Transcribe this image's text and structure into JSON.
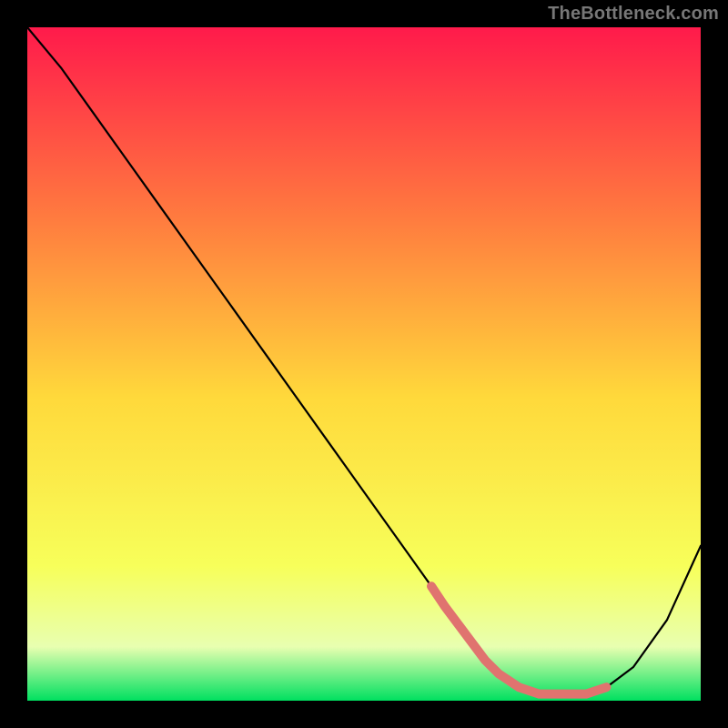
{
  "watermark": "TheBottleneck.com",
  "colors": {
    "frame_bg": "#000000",
    "gradient_top": "#ff1a4b",
    "gradient_mid1": "#ff7a3f",
    "gradient_mid2": "#ffd93b",
    "gradient_mid3": "#f7ff5a",
    "gradient_bottom_band": "#e8ffb0",
    "gradient_bottom": "#00e060",
    "curve": "#000000",
    "highlight": "#e0736f"
  },
  "chart_data": {
    "type": "line",
    "title": "",
    "xlabel": "",
    "ylabel": "",
    "xlim": [
      0,
      100
    ],
    "ylim": [
      0,
      100
    ],
    "grid": false,
    "legend": false,
    "series": [
      {
        "name": "bottleneck-curve",
        "x": [
          0,
          5,
          10,
          15,
          20,
          25,
          30,
          35,
          40,
          45,
          50,
          55,
          60,
          62,
          65,
          68,
          70,
          73,
          76,
          80,
          83,
          86,
          90,
          95,
          100
        ],
        "y": [
          100,
          94,
          87,
          80,
          73,
          66,
          59,
          52,
          45,
          38,
          31,
          24,
          17,
          14,
          10,
          6,
          4,
          2,
          1,
          1,
          1,
          2,
          5,
          12,
          23
        ]
      }
    ],
    "highlight_segment": {
      "description": "thick salmon overlay near curve minimum",
      "x": [
        60,
        62,
        65,
        68,
        70,
        73,
        76,
        80,
        83,
        86
      ],
      "y": [
        17,
        14,
        10,
        6,
        4,
        2,
        1,
        1,
        1,
        2
      ]
    },
    "annotations": []
  }
}
